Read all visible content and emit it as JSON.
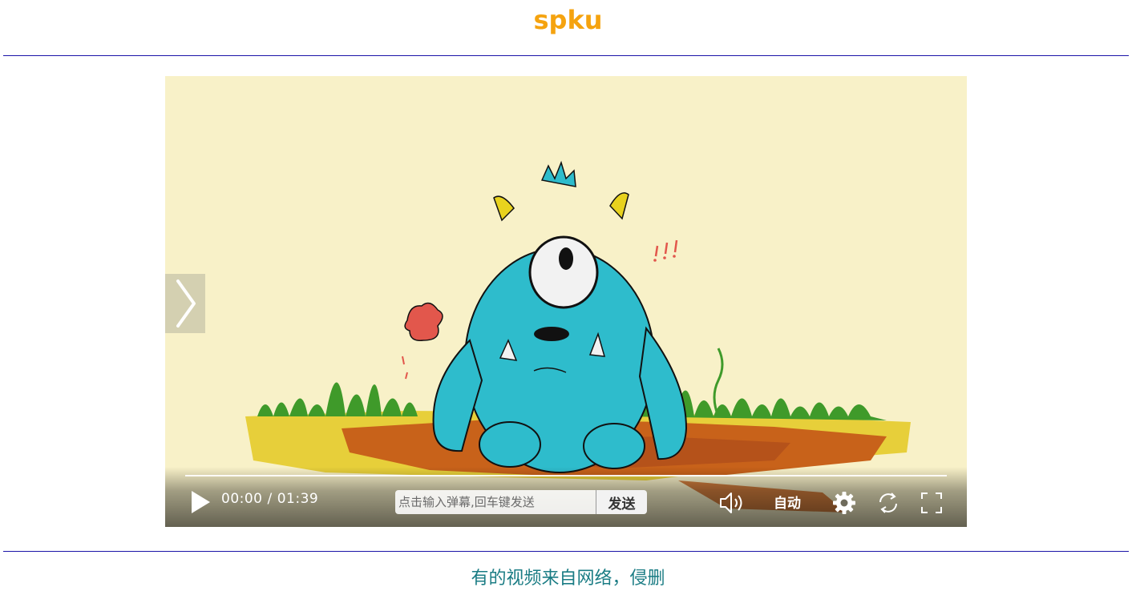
{
  "site": {
    "title": "spku"
  },
  "player": {
    "current_time": "00:00",
    "separator": "/",
    "duration": "01:39",
    "progress": 0,
    "danmaku_placeholder": "点击输入弹幕,回车键发送",
    "send_label": "发送",
    "quality_label": "自动"
  },
  "icons": {
    "prev_next": "chevron-right-icon",
    "play": "play-icon",
    "volume": "volume-icon",
    "settings": "gear-icon",
    "loop": "loop-icon",
    "fullscreen": "fullscreen-icon"
  },
  "colors": {
    "title": "#f5a30f",
    "rule": "#1a14a8",
    "footer": "#1a7c84",
    "video_bg": "#f8f1c8"
  },
  "footer": {
    "note": "有的视频来自网络，侵删"
  }
}
